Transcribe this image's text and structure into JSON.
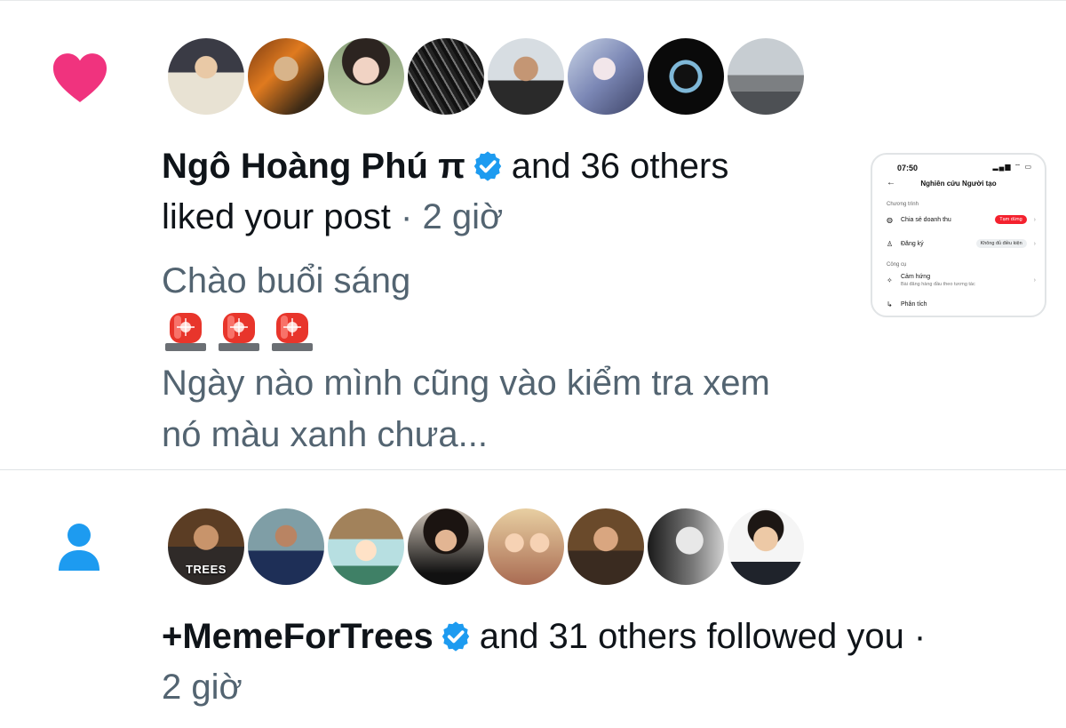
{
  "colors": {
    "like": "#f91880",
    "follow": "#1d9bf0",
    "verified": "#1d9bf0",
    "text": "#0f1419",
    "muted": "#536471"
  },
  "notifications": [
    {
      "type": "like",
      "icon": "heart-icon",
      "avatars_count": 8,
      "actor": "Ngô Hoàng Phú π",
      "verified": true,
      "summary": "and 36 others",
      "action": "liked your post",
      "time": "· 2 giờ",
      "post_text": {
        "line1": "Chào buổi sáng",
        "emoji": [
          "🚨",
          "🚨",
          "🚨"
        ],
        "line2": "Ngày nào mình cũng vào kiểm tra xem",
        "line3": "nó màu xanh chưa..."
      },
      "thumbnail": {
        "time": "07:50",
        "status_icons": "▂▄▆ ⌔ ▭",
        "title": "Nghiên cứu Người tạo",
        "section1": "Chương trình",
        "rows1": [
          {
            "icon": "revenue-share-icon",
            "label": "Chia sẻ doanh thu",
            "badge": "Tạm dừng"
          },
          {
            "icon": "subscription-icon",
            "label": "Đăng ký",
            "badge": "Không đủ điều kiện"
          }
        ],
        "section2": "Công cụ",
        "rows2": [
          {
            "icon": "sparkle-icon",
            "label": "Cảm hứng",
            "sub": "Bài đăng hàng đầu theo tương tác"
          },
          {
            "icon": "analytics-icon",
            "label": "Phân tích"
          }
        ]
      }
    },
    {
      "type": "follow",
      "icon": "person-icon",
      "avatars_count": 8,
      "avatar_caption": "TREES",
      "actor": "+MemeForTrees",
      "verified": true,
      "summary": "and 31 others followed you ·",
      "time": "2 giờ"
    }
  ]
}
